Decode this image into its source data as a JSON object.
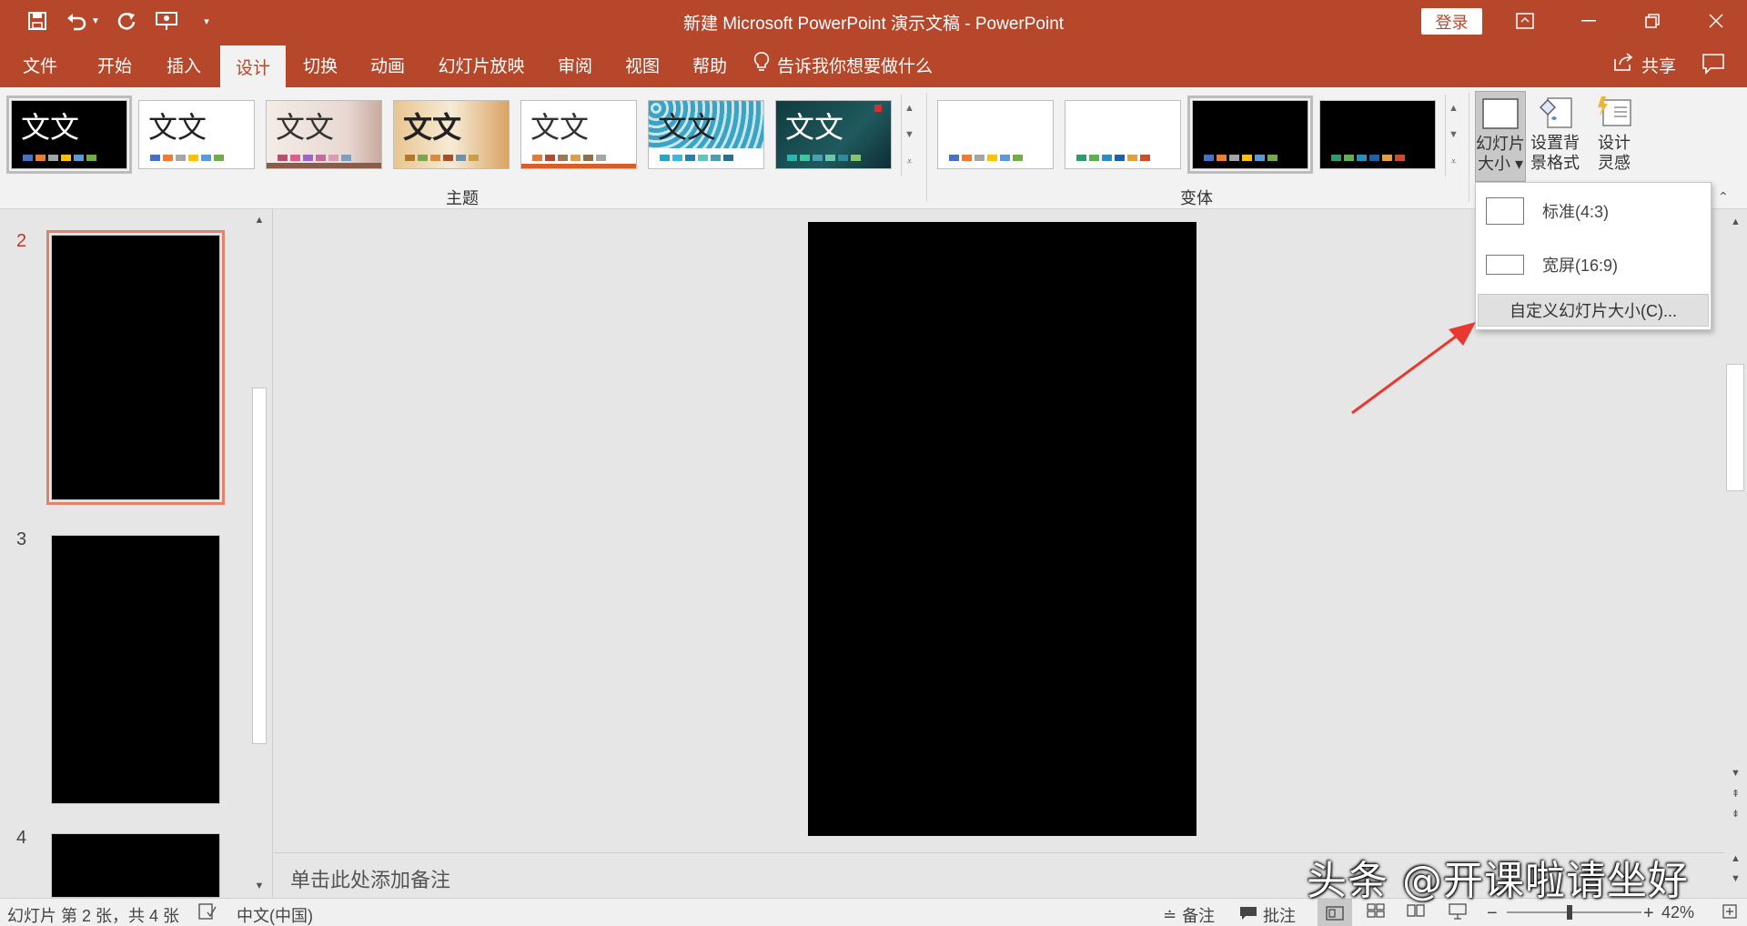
{
  "window": {
    "title": "新建 Microsoft PowerPoint 演示文稿  -  PowerPoint",
    "login_label": "登录"
  },
  "tabs": [
    {
      "label": "文件"
    },
    {
      "label": "开始"
    },
    {
      "label": "插入"
    },
    {
      "label": "设计",
      "active": true
    },
    {
      "label": "切换"
    },
    {
      "label": "动画"
    },
    {
      "label": "幻灯片放映"
    },
    {
      "label": "审阅"
    },
    {
      "label": "视图"
    },
    {
      "label": "帮助"
    }
  ],
  "tell_me": "告诉我你想要做什么",
  "share_label": "共享",
  "ribbon": {
    "themes_group_label": "主题",
    "variants_group_label": "变体",
    "theme_sample_text": "文文",
    "slide_size_label_1": "幻灯片",
    "slide_size_label_2": "大小",
    "format_bg_label_1": "设置背",
    "format_bg_label_2": "景格式",
    "designer_label_1": "设计",
    "designer_label_2": "灵感"
  },
  "slides": [
    {
      "number": "2",
      "active": true
    },
    {
      "number": "3"
    },
    {
      "number": "4"
    }
  ],
  "notes_placeholder": "单击此处添加备注",
  "dropdown": {
    "standard": "标准(4:3)",
    "widescreen": "宽屏(16:9)",
    "custom": "自定义幻灯片大小(C)..."
  },
  "statusbar": {
    "slide_info": "幻灯片 第 2 张，共 4 张",
    "language": "中文(中国)",
    "notes_label": "备注",
    "comments_label": "批注",
    "zoom": "42%"
  },
  "watermark": "头条 @开课啦请坐好",
  "colors": {
    "accent": "#b7472a",
    "ribbon_bg": "#f2f2f2",
    "canvas_bg": "#e6e6e6",
    "slide_bg": "#000000"
  }
}
